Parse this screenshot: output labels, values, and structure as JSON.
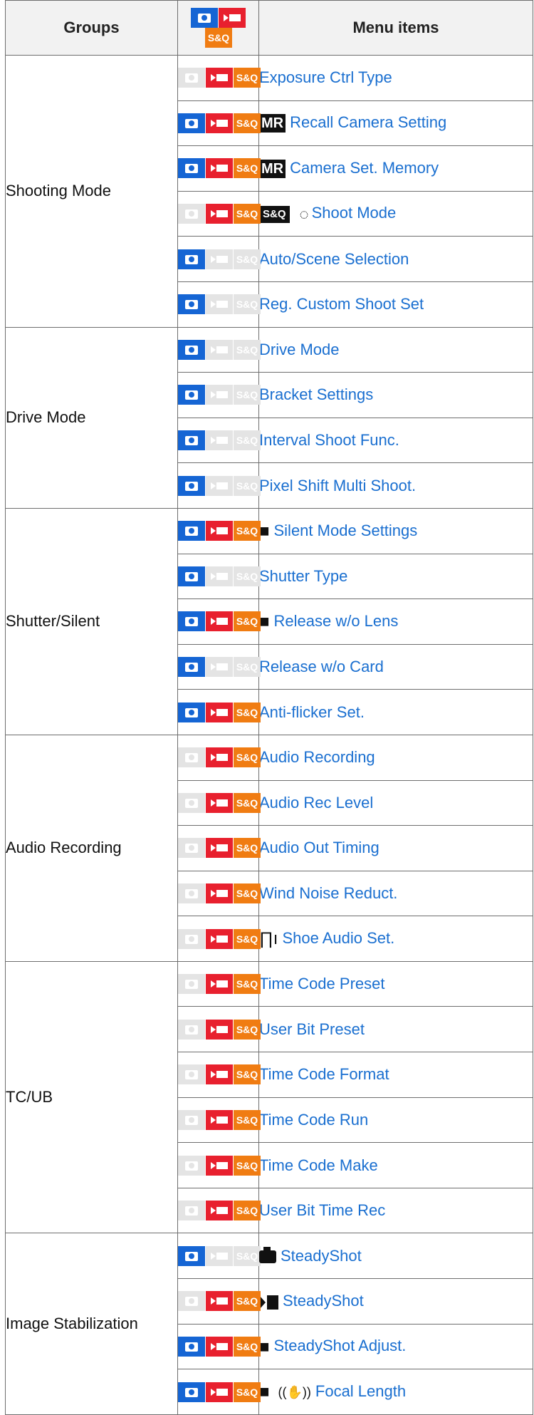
{
  "header": {
    "groups": "Groups",
    "items": "Menu items"
  },
  "mode_label": "S&Q",
  "colors": {
    "link": "#1a6fd0",
    "photo": "#1565d4",
    "movie": "#e8202e",
    "sq": "#f07c12",
    "inactive": "#e4e4e4"
  },
  "groups": [
    {
      "name": "Shooting Mode",
      "items": [
        {
          "modes": [
            false,
            true,
            true
          ],
          "prefix": null,
          "label": "Exposure Ctrl Type"
        },
        {
          "modes": [
            true,
            true,
            true
          ],
          "prefix": "MR",
          "label": "Recall Camera Setting"
        },
        {
          "modes": [
            true,
            true,
            true
          ],
          "prefix": "MR",
          "label": "Camera Set. Memory"
        },
        {
          "modes": [
            false,
            true,
            true
          ],
          "prefix": "S&Q",
          "label": "Shoot Mode"
        },
        {
          "modes": [
            true,
            false,
            false
          ],
          "prefix": null,
          "label": "Auto/Scene Selection"
        },
        {
          "modes": [
            true,
            false,
            false
          ],
          "prefix": null,
          "label": "Reg. Custom Shoot Set"
        }
      ]
    },
    {
      "name": "Drive Mode",
      "items": [
        {
          "modes": [
            true,
            false,
            false
          ],
          "prefix": null,
          "label": "Drive Mode"
        },
        {
          "modes": [
            true,
            false,
            false
          ],
          "prefix": null,
          "label": "Bracket Settings"
        },
        {
          "modes": [
            true,
            false,
            false
          ],
          "prefix": null,
          "label": "Interval Shoot Func."
        },
        {
          "modes": [
            true,
            false,
            false
          ],
          "prefix": null,
          "label": "Pixel Shift Multi Shoot."
        }
      ]
    },
    {
      "name": "Shutter/Silent",
      "items": [
        {
          "modes": [
            true,
            true,
            true
          ],
          "prefix": "photo-movie",
          "label": "Silent Mode Settings"
        },
        {
          "modes": [
            true,
            false,
            false
          ],
          "prefix": null,
          "label": "Shutter Type"
        },
        {
          "modes": [
            true,
            true,
            true
          ],
          "prefix": "photo-movie",
          "label": "Release w/o Lens"
        },
        {
          "modes": [
            true,
            false,
            false
          ],
          "prefix": null,
          "label": "Release w/o Card"
        },
        {
          "modes": [
            true,
            true,
            true
          ],
          "prefix": null,
          "label": "Anti-flicker Set."
        }
      ]
    },
    {
      "name": "Audio Recording",
      "items": [
        {
          "modes": [
            false,
            true,
            true
          ],
          "prefix": null,
          "label": "Audio Recording"
        },
        {
          "modes": [
            false,
            true,
            true
          ],
          "prefix": null,
          "label": "Audio Rec Level"
        },
        {
          "modes": [
            false,
            true,
            true
          ],
          "prefix": null,
          "label": "Audio Out Timing"
        },
        {
          "modes": [
            false,
            true,
            true
          ],
          "prefix": null,
          "label": "Wind Noise Reduct."
        },
        {
          "modes": [
            false,
            true,
            true
          ],
          "prefix": "shoe",
          "label": "Shoe Audio Set."
        }
      ]
    },
    {
      "name": "TC/UB",
      "items": [
        {
          "modes": [
            false,
            true,
            true
          ],
          "prefix": null,
          "label": "Time Code Preset"
        },
        {
          "modes": [
            false,
            true,
            true
          ],
          "prefix": null,
          "label": "User Bit Preset"
        },
        {
          "modes": [
            false,
            true,
            true
          ],
          "prefix": null,
          "label": "Time Code Format"
        },
        {
          "modes": [
            false,
            true,
            true
          ],
          "prefix": null,
          "label": "Time Code Run"
        },
        {
          "modes": [
            false,
            true,
            true
          ],
          "prefix": null,
          "label": "Time Code Make"
        },
        {
          "modes": [
            false,
            true,
            true
          ],
          "prefix": null,
          "label": "User Bit Time Rec"
        }
      ]
    },
    {
      "name": "Image Stabilization",
      "items": [
        {
          "modes": [
            true,
            false,
            false
          ],
          "prefix": "photo",
          "label": "SteadyShot"
        },
        {
          "modes": [
            false,
            true,
            true
          ],
          "prefix": "movie",
          "label": "SteadyShot"
        },
        {
          "modes": [
            true,
            true,
            true
          ],
          "prefix": "photo-movie",
          "label": "SteadyShot Adjust."
        },
        {
          "modes": [
            true,
            true,
            true
          ],
          "prefix": "photo-movie-shake",
          "label": "Focal Length"
        }
      ]
    }
  ]
}
